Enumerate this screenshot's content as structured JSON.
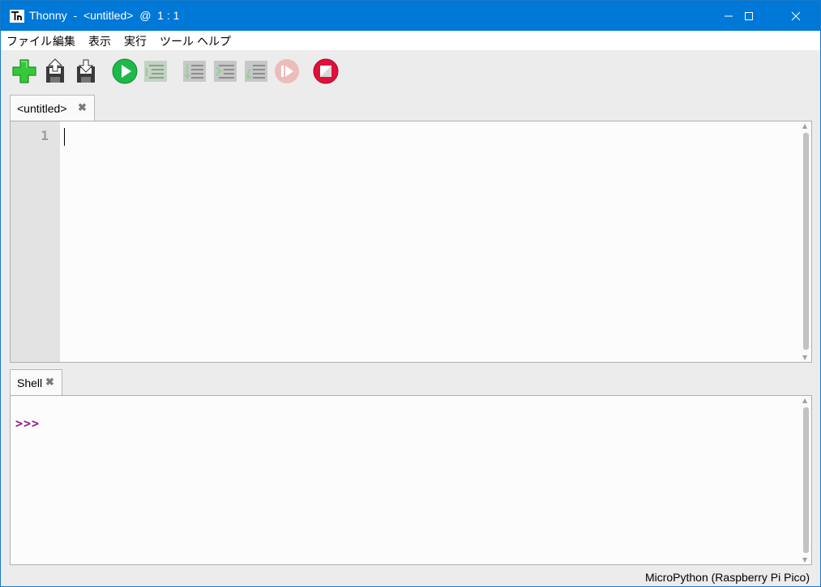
{
  "window": {
    "title": "Thonny  -  <untitled>  @  1 : 1",
    "controls": {
      "minimize": "minimize",
      "maximize": "maximize",
      "close": "close"
    }
  },
  "menubar": {
    "items": [
      "ファイル",
      "編集",
      "表示",
      "実行",
      "ツール",
      "ヘルプ"
    ]
  },
  "toolbar": {
    "buttons": [
      {
        "icon": "new-file-icon",
        "enabled": true
      },
      {
        "icon": "open-file-icon",
        "enabled": true
      },
      {
        "icon": "save-file-icon",
        "enabled": true
      },
      {
        "icon": "run-icon",
        "enabled": true
      },
      {
        "icon": "debug-icon",
        "enabled": false
      },
      {
        "icon": "step-over-icon",
        "enabled": false
      },
      {
        "icon": "step-into-icon",
        "enabled": false
      },
      {
        "icon": "step-out-icon",
        "enabled": false
      },
      {
        "icon": "resume-icon",
        "enabled": false
      },
      {
        "icon": "stop-icon",
        "enabled": true
      }
    ]
  },
  "editor": {
    "tab_label": "<untitled>",
    "close_glyph": "✖",
    "line_numbers": [
      "1"
    ]
  },
  "shell": {
    "tab_label": "Shell",
    "close_glyph": "✖",
    "prompt": ">>>"
  },
  "statusbar": {
    "interpreter": "MicroPython (Raspberry Pi Pico)"
  },
  "colors": {
    "titlebar": "#0078d7",
    "prompt": "#8b1a8b",
    "run_green": "#1fb84a",
    "stop_red": "#e0103a"
  }
}
